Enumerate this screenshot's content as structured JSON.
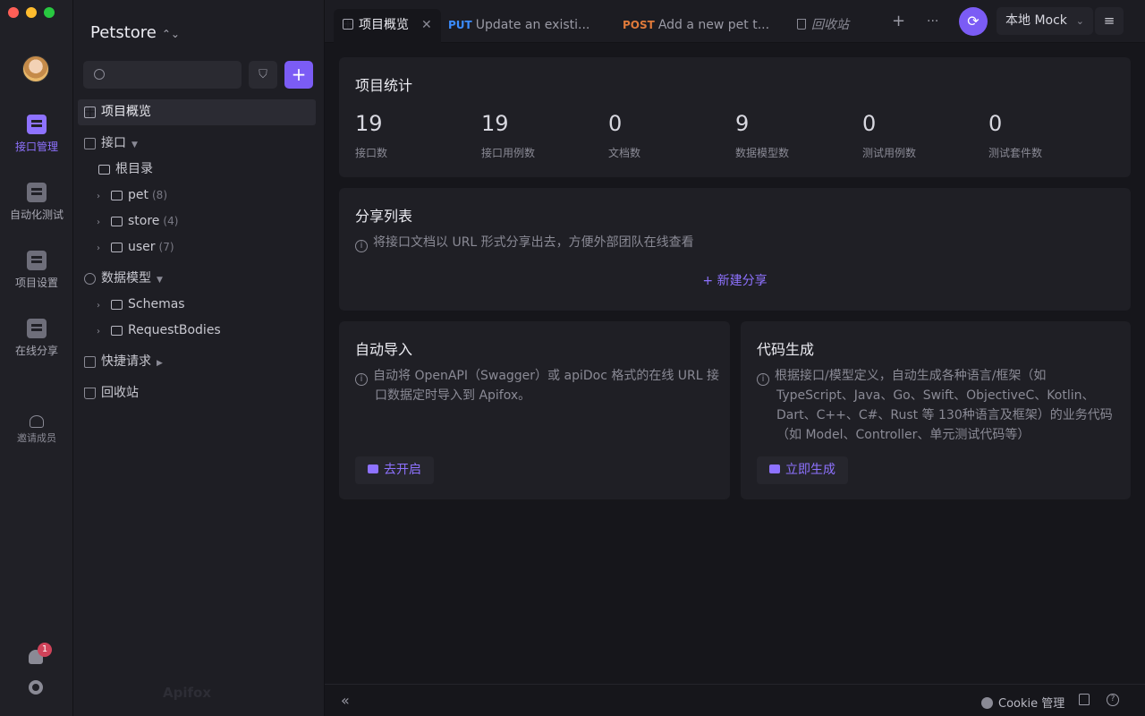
{
  "window": {
    "traffic_colors": [
      "#ff5f57",
      "#febc2e",
      "#28c840"
    ]
  },
  "rail": {
    "items": [
      {
        "label": "接口管理",
        "icon": "api-manage-icon",
        "active": true
      },
      {
        "label": "自动化测试",
        "icon": "automation-icon"
      },
      {
        "label": "项目设置",
        "icon": "project-settings-icon"
      },
      {
        "label": "在线分享",
        "icon": "online-share-icon"
      }
    ],
    "invite_label": "邀请成员",
    "notification_count": "1"
  },
  "tree": {
    "project_name": "Petstore",
    "project_chevron": "⌃⌄",
    "filter_icon": "⛉",
    "add_icon": "+",
    "overview_label": "项目概览",
    "api_section": "接口",
    "root_folder": "根目录",
    "folders": [
      {
        "name": "pet",
        "count": "(8)"
      },
      {
        "name": "store",
        "count": "(4)"
      },
      {
        "name": "user",
        "count": "(7)"
      }
    ],
    "models_section": "数据模型",
    "model_folders": [
      {
        "name": "Schemas"
      },
      {
        "name": "RequestBodies"
      }
    ],
    "quick_request": "快捷请求",
    "recycle_bin": "回收站",
    "watermark": "Apifox"
  },
  "tabs": {
    "active_label": "项目概览",
    "close_icon": "✕",
    "put_method": "PUT",
    "put_label": "Update an existi...",
    "post_method": "POST",
    "post_label": "Add a new pet t...",
    "trash_label": "回收站",
    "plus": "+",
    "more": "···",
    "sync_icon": "⟳",
    "env_name": "本地 Mock",
    "env_caret": "⌄",
    "menu_icon": "≡"
  },
  "stats": {
    "title": "项目统计",
    "items": [
      {
        "value": "19",
        "label": "接口数"
      },
      {
        "value": "19",
        "label": "接口用例数"
      },
      {
        "value": "0",
        "label": "文档数"
      },
      {
        "value": "9",
        "label": "数据模型数"
      },
      {
        "value": "0",
        "label": "测试用例数"
      },
      {
        "value": "0",
        "label": "测试套件数"
      }
    ]
  },
  "share": {
    "title": "分享列表",
    "hint": "将接口文档以 URL 形式分享出去，方便外部团队在线查看",
    "new_share": "+ 新建分享"
  },
  "auto_import": {
    "title": "自动导入",
    "hint_line1": "自动将 OpenAPI（Swagger）或 apiDoc 格式的在线 URL 接",
    "hint_line2": "口数据定时导入到 Apifox。",
    "button": "去开启"
  },
  "codegen": {
    "title": "代码生成",
    "hint_line1": "根据接口/模型定义，自动生成各种语言/框架（如",
    "hint_line2": "TypeScript、Java、Go、Swift、ObjectiveC、Kotlin、",
    "hint_line3": "Dart、C++、C#、Rust 等 130种语言及框架）的业务代码",
    "hint_line4": "（如 Model、Controller、单元测试代码等）",
    "button": "立即生成"
  },
  "bottom": {
    "collapse_icon": "«",
    "cookie_label": "Cookie 管理",
    "help_icon": "?"
  }
}
